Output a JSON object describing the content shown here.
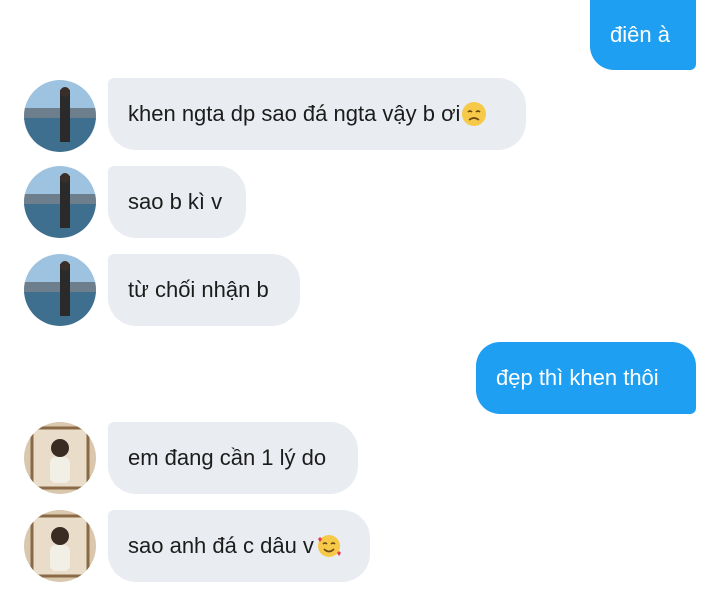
{
  "messages": [
    {
      "side": "out",
      "text": "điên à"
    },
    {
      "side": "in",
      "sender": "user-a",
      "text": "khen ngta dp sao đá ngta vậy b ơi",
      "emoji": "disappointed-face"
    },
    {
      "side": "in",
      "sender": "user-a",
      "text": "sao b kì v"
    },
    {
      "side": "in",
      "sender": "user-a",
      "text": "từ chối nhận b"
    },
    {
      "side": "out",
      "text": "đẹp thì khen thôi"
    },
    {
      "side": "in",
      "sender": "user-b",
      "text": "em đang cần 1 lý do"
    },
    {
      "side": "in",
      "sender": "user-b",
      "text": "sao anh đá c dâu v",
      "emoji": "smiling-face-with-hearts"
    }
  ],
  "colors": {
    "outgoing_bubble": "#1e9ff2",
    "incoming_bubble": "#e9edf1",
    "outgoing_text": "#ffffff",
    "incoming_text": "#1c1c1c"
  }
}
